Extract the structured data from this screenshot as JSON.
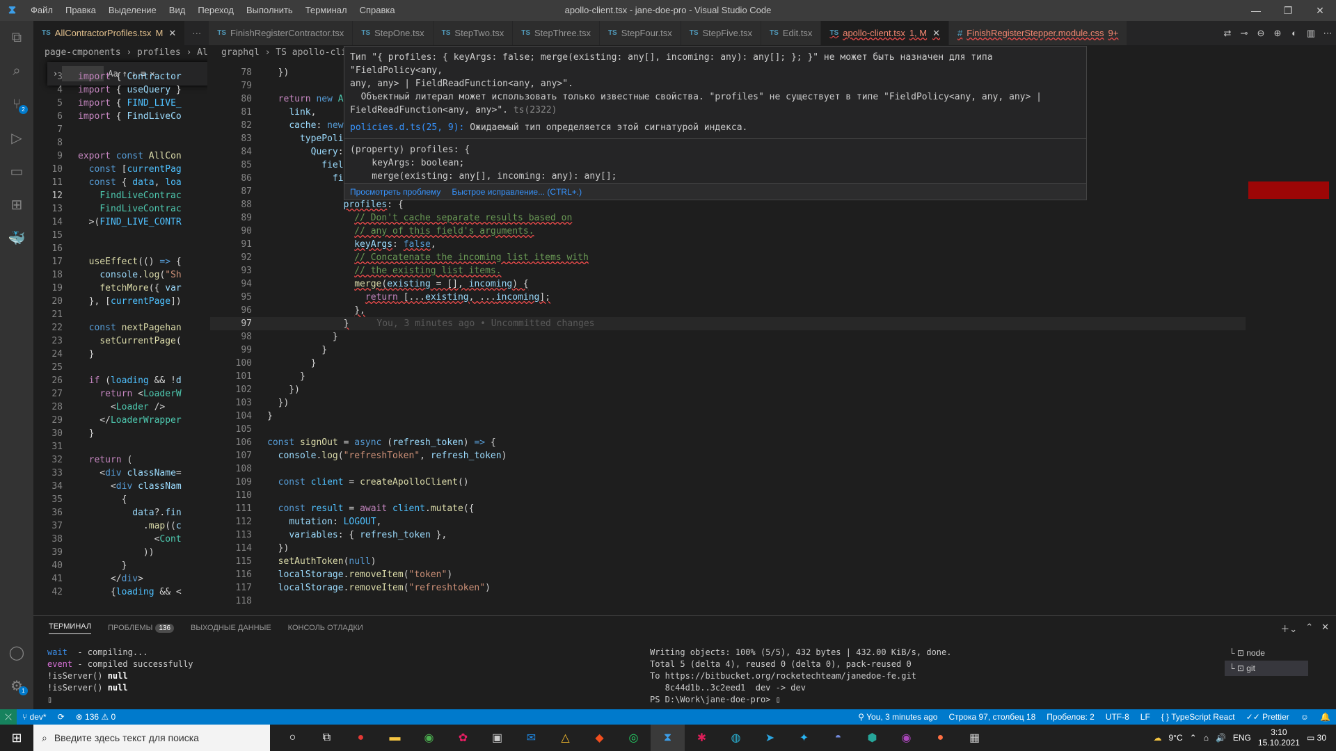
{
  "menu": {
    "items": [
      "Файл",
      "Правка",
      "Выделение",
      "Вид",
      "Переход",
      "Выполнить",
      "Терминал",
      "Справка"
    ]
  },
  "window": {
    "title": "apollo-client.tsx - jane-doe-pro - Visual Studio Code"
  },
  "tabs": [
    {
      "label": "AllContractorProfiles.tsx",
      "mod": "M",
      "kind": "ts"
    },
    {
      "label": "FinishRegisterContractor.tsx",
      "mod": "",
      "kind": "ts"
    },
    {
      "label": "StepOne.tsx",
      "mod": "",
      "kind": "ts"
    },
    {
      "label": "StepTwo.tsx",
      "mod": "",
      "kind": "ts"
    },
    {
      "label": "StepThree.tsx",
      "mod": "",
      "kind": "ts"
    },
    {
      "label": "StepFour.tsx",
      "mod": "",
      "kind": "ts"
    },
    {
      "label": "StepFive.tsx",
      "mod": "",
      "kind": "ts"
    },
    {
      "label": "Edit.tsx",
      "mod": "",
      "kind": "ts"
    },
    {
      "label": "apollo-client.tsx",
      "mod": "1, M",
      "kind": "ts"
    },
    {
      "label": "FinishRegisterStepper.module.css",
      "mod": "9+",
      "kind": "css"
    }
  ],
  "editor_left": {
    "breadcrumb": "page-cmponents › profiles › AllContracto"
  },
  "editor_right": {
    "breadcrumb": "graphql › TS apollo-client.tsx"
  },
  "hover": {
    "line1": "Тип \"{ profiles: { keyArgs: false; merge(existing: any[], incoming: any): any[]; }; }\" не может быть назначен для типа \"FieldPolicy<any,",
    "line2": "any, any> | FieldReadFunction<any, any>\".",
    "line3": "  Объектный литерал может использовать только известные свойства. \"profiles\" не существует в типе \"FieldPolicy<any, any, any> |",
    "line4": "FieldReadFunction<any, any>\".",
    "code": "ts(2322)",
    "related_link": "policies.d.ts(25, 9):",
    "related_text": "Ожидаемый тип определяется этой сигнатурой индекса.",
    "sig1": "(property) profiles: {",
    "sig2": "    keyArgs: boolean;",
    "sig3": "    merge(existing: any[], incoming: any): any[];",
    "sig4": "}",
    "view_problem": "Просмотреть проблему",
    "quick_fix": "Быстрое исправление... (CTRL+.)"
  },
  "panel": {
    "tabs": [
      "ТЕРМИНАЛ",
      "ПРОБЛЕМЫ",
      "ВЫХОДНЫЕ ДАННЫЕ",
      "КОНСОЛЬ ОТЛАДКИ"
    ],
    "problems_count": "136",
    "terminals": [
      "node",
      "git"
    ]
  },
  "status": {
    "branch": "dev*",
    "errors": "136",
    "warnings": "0",
    "blame": "You, 3 minutes ago",
    "position": "Строка 97, столбец 18",
    "spaces": "Пробелов: 2",
    "encoding": "UTF-8",
    "eol": "LF",
    "language": "TypeScript React",
    "prettier": "Prettier"
  },
  "taskbar": {
    "search_placeholder": "Введите здесь текст для поиска",
    "temp": "9°C",
    "lang": "ENG",
    "time": "3:10",
    "date": "15.10.2021",
    "notif": "30"
  }
}
